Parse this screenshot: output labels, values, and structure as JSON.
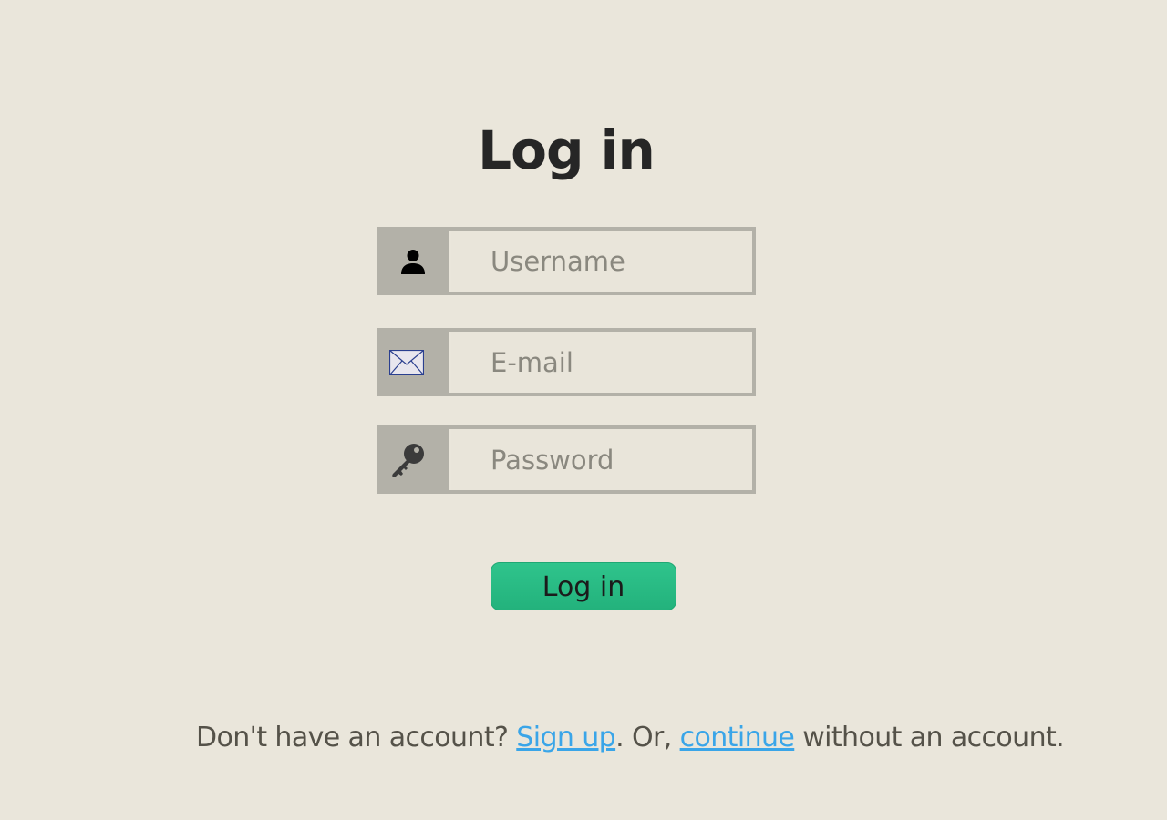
{
  "title": "Log in",
  "form": {
    "username": {
      "placeholder": "Username",
      "value": "",
      "icon": "person-icon"
    },
    "email": {
      "placeholder": "E-mail",
      "value": "",
      "icon": "envelope-icon"
    },
    "password": {
      "placeholder": "Password",
      "value": "",
      "icon": "key-icon"
    },
    "submit_label": "Log in"
  },
  "footer": {
    "prefix": "Don't have an account? ",
    "signup_link": "Sign up",
    "middle": ". Or, ",
    "continue_link": "continue",
    "suffix": " without an account."
  },
  "colors": {
    "background": "#eae6db",
    "field_border": "#b3b1a8",
    "button": "#2fc48c",
    "link": "#3aa5e8"
  }
}
